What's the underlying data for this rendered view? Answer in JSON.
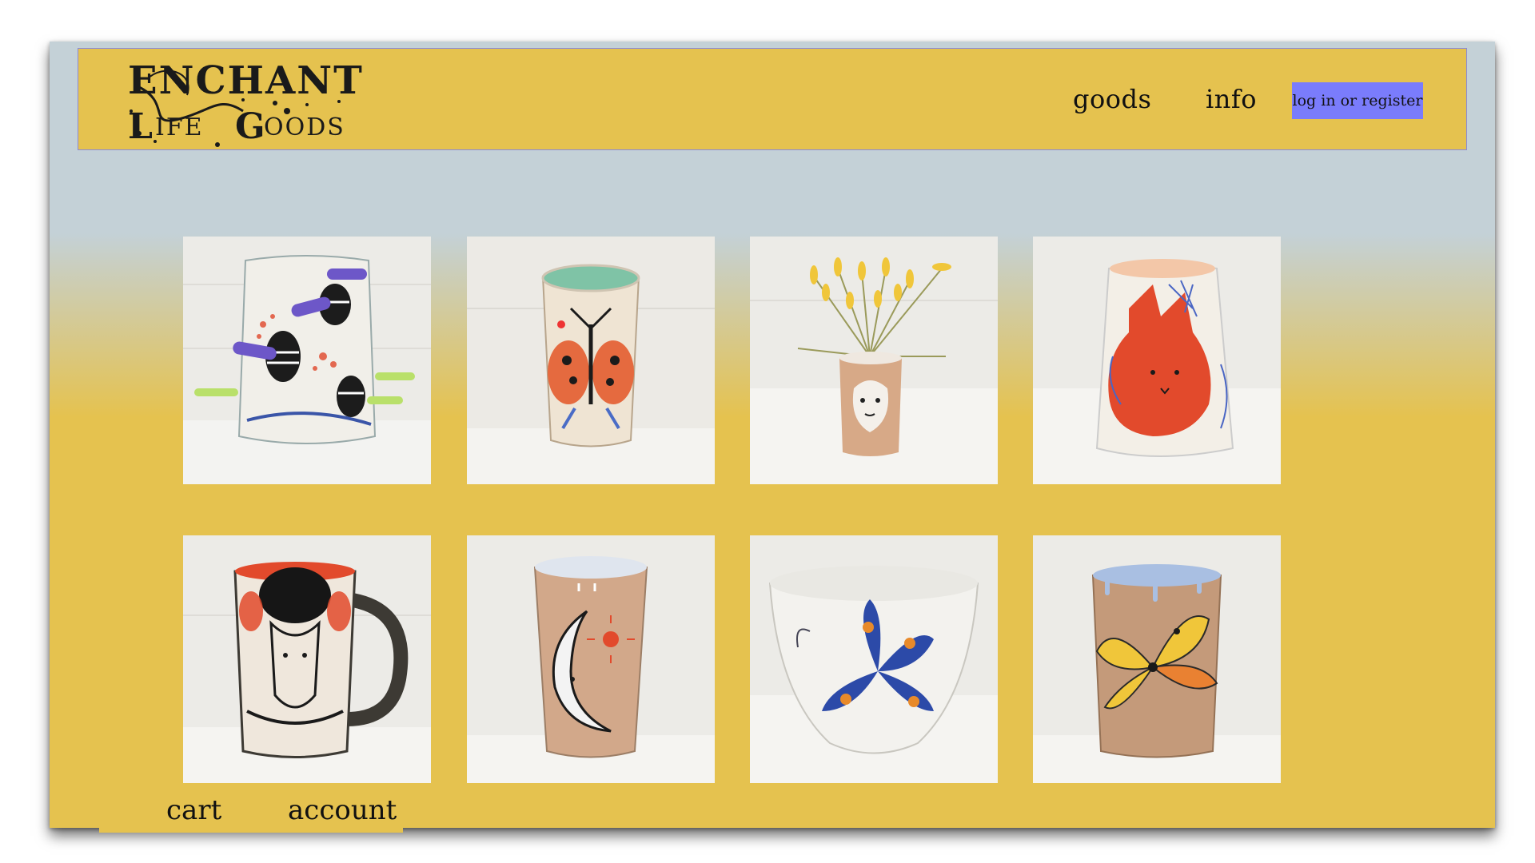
{
  "header": {
    "logo_text_line1": "Enchanted",
    "logo_text_line2": "Life Goods",
    "nav": [
      {
        "label": "goods"
      },
      {
        "label": "info"
      }
    ],
    "login_label": "log in or register",
    "login_color": "#7a7cfc"
  },
  "colors": {
    "header_bg": "#e5c24f",
    "page_top": "#c4d1d7",
    "page_bottom": "#e5c24f"
  },
  "products": [
    {
      "icon": "mug-with-bees-image"
    },
    {
      "icon": "cup-with-bug-image"
    },
    {
      "icon": "vase-with-face-and-flowers-image"
    },
    {
      "icon": "vase-with-red-rabbit-image"
    },
    {
      "icon": "mug-with-figures-image"
    },
    {
      "icon": "cup-with-moon-image"
    },
    {
      "icon": "bowl-with-butterfly-image"
    },
    {
      "icon": "cup-with-yellow-creature-image"
    }
  ],
  "footer": {
    "cart_label": "cart",
    "account_label": "account"
  }
}
